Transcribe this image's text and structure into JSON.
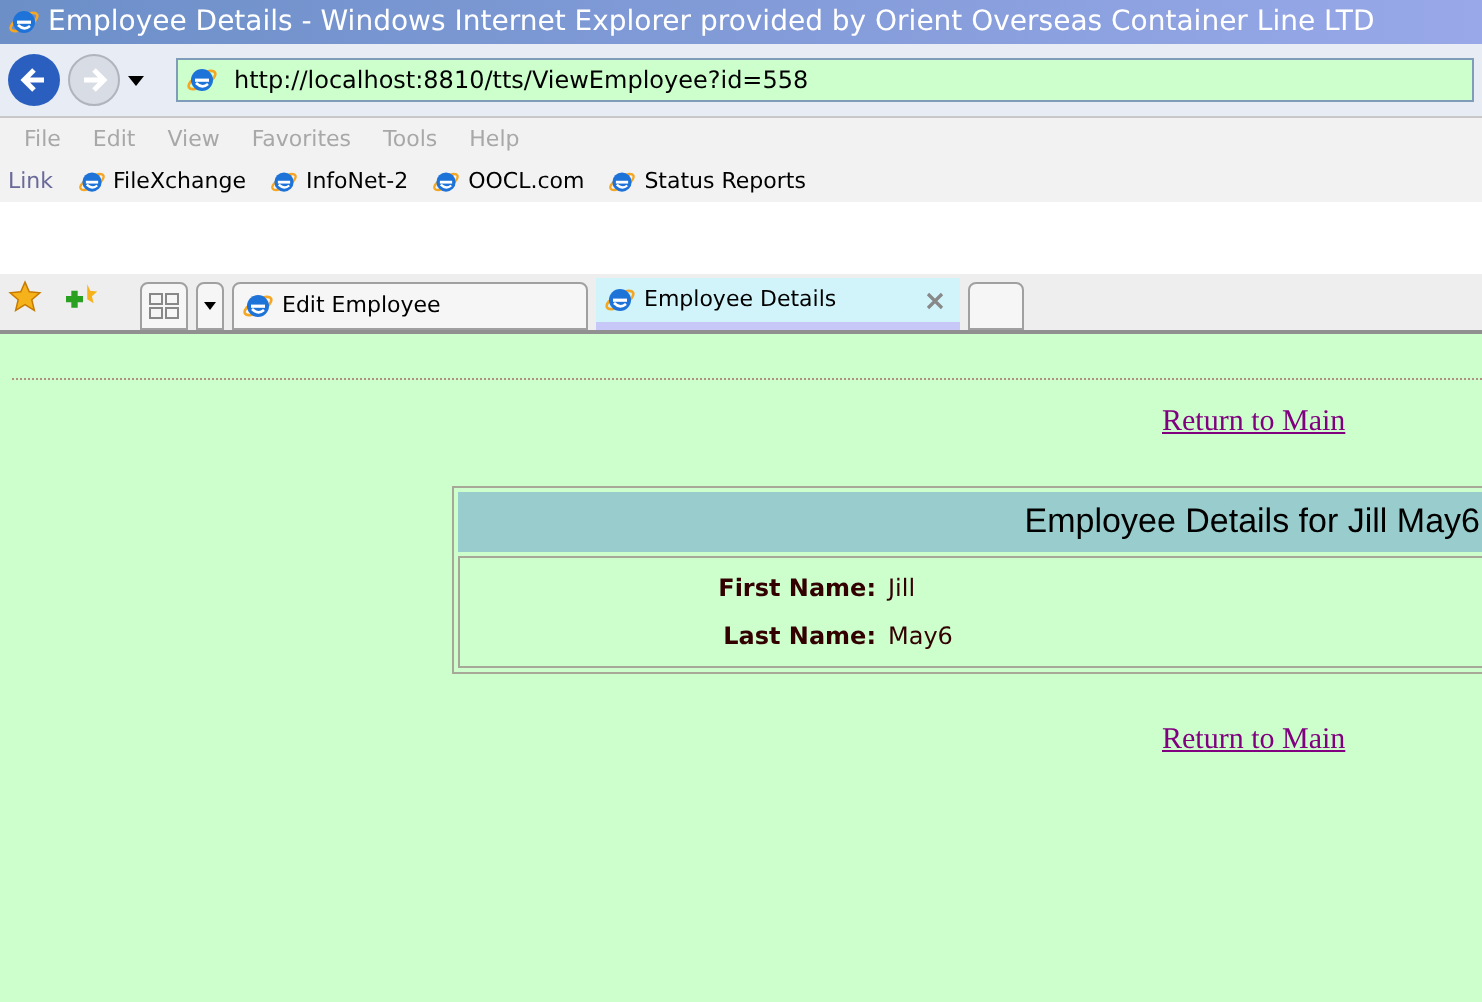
{
  "window": {
    "title": "Employee Details - Windows Internet Explorer provided by Orient Overseas Container Line LTD"
  },
  "address_bar": {
    "value": "http://localhost:8810/tts/ViewEmployee?id=558"
  },
  "menu": [
    {
      "label": "File",
      "disabled": true
    },
    {
      "label": "Edit",
      "disabled": true
    },
    {
      "label": "View",
      "disabled": true
    },
    {
      "label": "Favorites",
      "disabled": true
    },
    {
      "label": "Tools",
      "disabled": true
    },
    {
      "label": "Help",
      "disabled": true
    }
  ],
  "links_bar": {
    "label": "Link",
    "items": [
      "FileXchange",
      "InfoNet-2",
      "OOCL.com",
      "Status Reports"
    ]
  },
  "tabs": [
    {
      "label": "Edit Employee",
      "selected": false
    },
    {
      "label": "Employee Details",
      "selected": true
    }
  ],
  "page": {
    "top_link": "Return to Main",
    "heading": "Employee Details for Jill May6",
    "fields": [
      {
        "label": "First Name:",
        "value": "Jill"
      },
      {
        "label": "Last Name:",
        "value": "May6"
      }
    ],
    "bottom_link": "Return to Main"
  }
}
